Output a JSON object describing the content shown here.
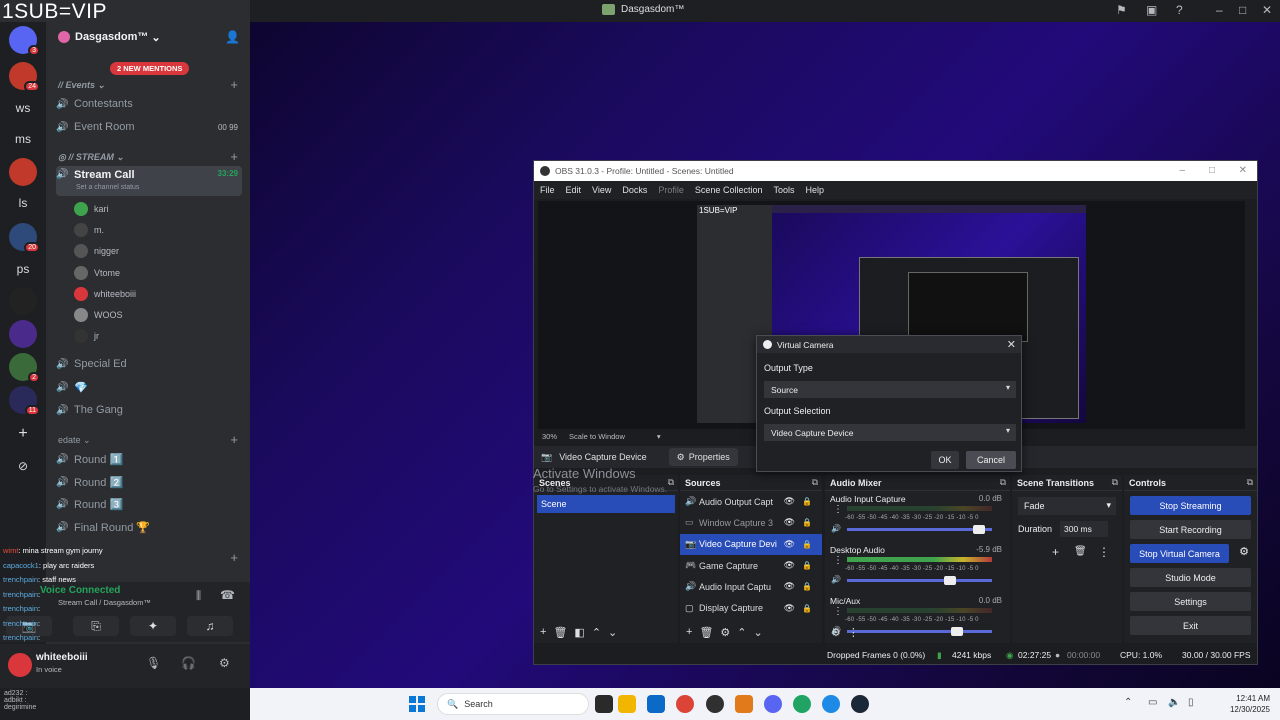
{
  "overlay": {
    "title": "1SUB=VIP"
  },
  "discord": {
    "window_title": "Dasgasdom™",
    "server_name": "Dasgasdom™",
    "mentions_pill": "2 NEW MENTIONS",
    "guild_rail": [
      {
        "label": "",
        "badge": "3"
      },
      {
        "label": "",
        "badge": "24"
      },
      {
        "label": "ws",
        "badge": ""
      },
      {
        "label": "ms",
        "badge": ""
      },
      {
        "label": "",
        "badge": ""
      },
      {
        "label": "ls",
        "badge": ""
      },
      {
        "label": "",
        "badge": "20"
      },
      {
        "label": "ps",
        "badge": ""
      },
      {
        "label": "",
        "badge": ""
      },
      {
        "label": "",
        "badge": ""
      },
      {
        "label": "",
        "badge": "2"
      },
      {
        "label": "",
        "badge": "11"
      }
    ],
    "categories": {
      "events": "// Events",
      "stream": "// STREAM",
      "edate": "edate"
    },
    "channels": {
      "contestants": "Contestants",
      "event_room": "Event Room",
      "event_room_counter": "00 99",
      "stream_call": "Stream Call",
      "stream_call_time": "33:29",
      "stream_call_status": "Set a channel status",
      "special_ed": "Special Ed",
      "the_gang": "The Gang",
      "round1": "Round 1️⃣",
      "round2": "Round 2️⃣",
      "round3": "Round 3️⃣",
      "final_round": "Final Round 🏆"
    },
    "voice_users": [
      "kari",
      "m.",
      "nigger",
      "Vtome",
      "whiteeboiii",
      "WOOS",
      "jr"
    ],
    "chat_overlay": [
      {
        "name": "wimt",
        "text": ": mina stream gym journy"
      },
      {
        "name": "capacock1",
        "text": ": play arc raiders"
      },
      {
        "name": "trenchpain",
        "text": ": staff news"
      },
      {
        "name": "trenchpain",
        "text": ":"
      },
      {
        "name": "trenchpain",
        "text": ":"
      },
      {
        "name": "trenchpain",
        "text": ":"
      },
      {
        "name": "trenchpain",
        "text": ":"
      }
    ],
    "voice_panel": {
      "status": "Voice Connected",
      "channel": "Stream Call / Dasgasdom™"
    },
    "user_panel": {
      "name": "whiteeboiii",
      "status": "In voice"
    },
    "bottom_strip": [
      "ad232 :",
      "adbikt :",
      "degirimine "
    ]
  },
  "obs": {
    "title": "OBS 31.0.3 - Profile: Untitled - Scenes: Untitled",
    "menu": [
      "File",
      "Edit",
      "View",
      "Docks",
      "Profile",
      "Scene Collection",
      "Tools",
      "Help"
    ],
    "preview_overlay": "1SUB=VIP",
    "zoom": "30%",
    "scale_mode": "Scale to Window",
    "selected_source": "Video Capture Device",
    "properties_label": "Properties",
    "docks": {
      "scenes": "Scenes",
      "sources": "Sources",
      "audio_mixer": "Audio Mixer",
      "scene_transitions": "Scene Transitions",
      "controls": "Controls"
    },
    "scenes": [
      "Scene"
    ],
    "sources": [
      {
        "name": "Audio Output Capt",
        "icon": "speaker-icon"
      },
      {
        "name": "Window Capture 3",
        "icon": "window-icon"
      },
      {
        "name": "Video Capture Devi",
        "icon": "camera-icon"
      },
      {
        "name": "Game Capture",
        "icon": "gamepad-icon"
      },
      {
        "name": "Audio Input Captu",
        "icon": "speaker-icon"
      },
      {
        "name": "Display Capture",
        "icon": "monitor-icon"
      }
    ],
    "mixer": [
      {
        "name": "Audio Input Capture",
        "db": "0.0 dB",
        "level": 0.0,
        "fader": 0.95
      },
      {
        "name": "Desktop Audio",
        "db": "-5.9 dB",
        "level": 0.97,
        "fader": 0.75
      },
      {
        "name": "Mic/Aux",
        "db": "0.0 dB",
        "level": 0.0,
        "fader": 0.8
      }
    ],
    "meter_scale": "-60 -55 -50 -45 -40 -35 -30 -25 -20 -15 -10 -5 0",
    "transition": "Fade",
    "duration_label": "Duration",
    "duration_value": "300 ms",
    "controls": [
      {
        "label": "Stop Streaming",
        "active": true
      },
      {
        "label": "Start Recording",
        "active": false
      },
      {
        "label": "Stop Virtual Camera",
        "active": true
      },
      {
        "label": "Studio Mode",
        "active": false
      },
      {
        "label": "Settings",
        "active": false
      },
      {
        "label": "Exit",
        "active": false
      }
    ],
    "status": {
      "dropped": "Dropped Frames 0 (0.0%)",
      "bitrate": "4241 kbps",
      "time": "02:27:25",
      "time2": "00:00:00",
      "cpu": "CPU: 1.0%",
      "fps": "30.00 / 30.00 FPS"
    }
  },
  "watermark": {
    "line1": "Activate Windows",
    "line2": "Go to Settings to activate Windows."
  },
  "vcam_dialog": {
    "title": "Virtual Camera",
    "output_type_label": "Output Type",
    "output_type": "Source",
    "output_selection_label": "Output Selection",
    "output_selection": "Video Capture Device",
    "ok": "OK",
    "cancel": "Cancel"
  },
  "taskbar": {
    "search_placeholder": "Search",
    "time": "12:41 AM",
    "date": "12/30/2025"
  }
}
